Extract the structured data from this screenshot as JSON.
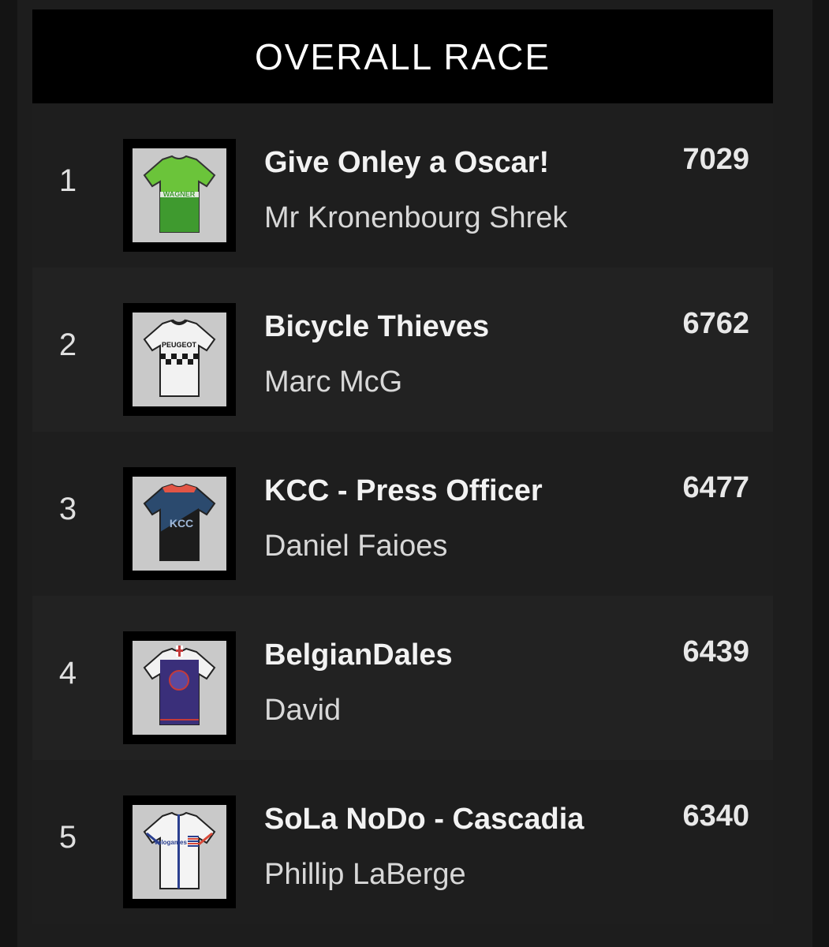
{
  "header": {
    "title": "OVERALL RACE"
  },
  "colors": {
    "background": "#141414",
    "panel": "#1d1d1d",
    "header_bg": "#000000",
    "text_primary": "#f2f2f2"
  },
  "standings": [
    {
      "rank": "1",
      "team": "Give Onley a Oscar!",
      "owner": "Mr Kronenbourg Shrek",
      "points": "7029",
      "jersey": {
        "icon": "green-wagner-jersey-icon",
        "sponsor": "WAGNER",
        "primary": "#6bc43a",
        "secondary": "#3f9a2f",
        "accent": "#ffffff"
      }
    },
    {
      "rank": "2",
      "team": "Bicycle Thieves",
      "owner": "Marc McG",
      "points": "6762",
      "jersey": {
        "icon": "white-peugeot-jersey-icon",
        "sponsor": "PEUGEOT",
        "primary": "#f2f2f2",
        "secondary": "#1a1a1a",
        "accent": "#1a1a1a"
      }
    },
    {
      "rank": "3",
      "team": "KCC - Press Officer",
      "owner": "Daniel Faioes",
      "points": "6477",
      "jersey": {
        "icon": "navy-kcc-jersey-icon",
        "sponsor": "KCC",
        "primary": "#2b4a6e",
        "secondary": "#1c1c1c",
        "accent": "#e25545"
      }
    },
    {
      "rank": "4",
      "team": "BelgianDales",
      "owner": "David",
      "points": "6439",
      "jersey": {
        "icon": "purple-crest-jersey-icon",
        "sponsor": "",
        "primary": "#3a2f7a",
        "secondary": "#ffffff",
        "accent": "#c43a3a"
      }
    },
    {
      "rank": "5",
      "team": "SoLa NoDo - Cascadia",
      "owner": "Phillip LaBerge",
      "points": "6340",
      "jersey": {
        "icon": "white-velogames-jersey-icon",
        "sponsor": "Velogames",
        "primary": "#f4f4f4",
        "secondary": "#2a3f8f",
        "accent": "#d84a3a"
      }
    }
  ]
}
